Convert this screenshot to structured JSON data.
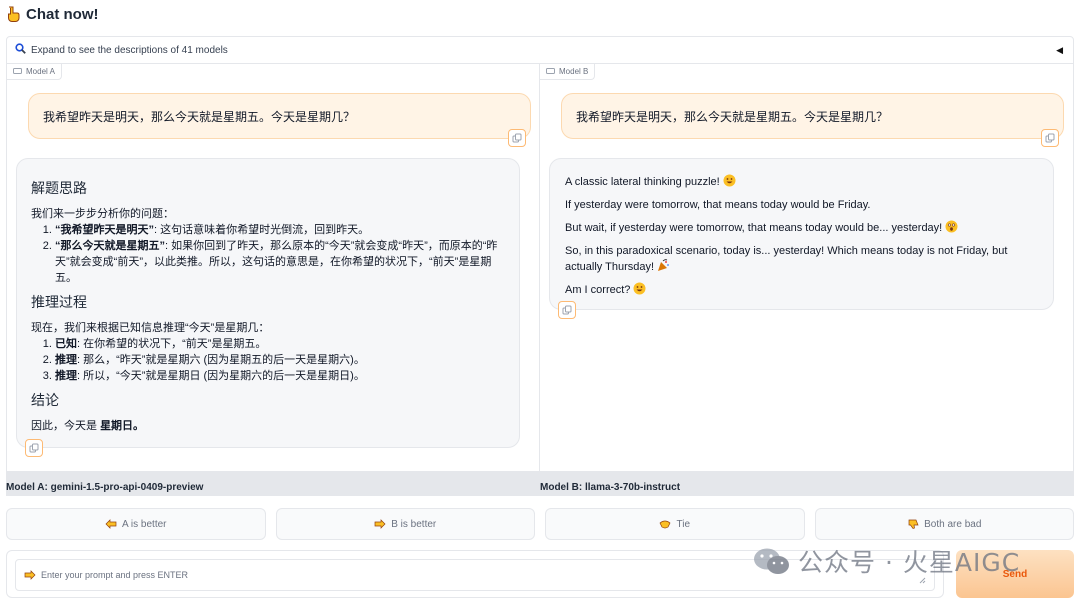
{
  "header": {
    "title": "Chat now!",
    "title_icon": "pointing-hand-icon"
  },
  "accordion": {
    "text": "Expand to see the descriptions of 41 models",
    "icon": "search-icon",
    "arrow": "◀"
  },
  "model_a": {
    "tab_label": "Model A",
    "user_message": "我希望昨天是明天，那么今天就是星期五。今天是星期几？",
    "response": {
      "h1": "解题思路",
      "intro": "我们来一步步分析你的问题：",
      "step1_bold": "“我希望昨天是明天”",
      "step1_text": ": 这句话意味着你希望时光倒流，回到昨天。",
      "step2_bold": "“那么今天就是星期五”",
      "step2_text": ": 如果你回到了昨天，那么原本的“今天”就会变成“昨天”，而原本的“昨天”就会变成“前天”，以此类推。所以，这句话的意思是，在你希望的状况下，“前天”是星期五。",
      "h2": "推理过程",
      "intro2": "现在，我们来根据已知信息推理“今天”是星期几：",
      "r1_bold": "已知",
      "r1_text": ": 在你希望的状况下，“前天”是星期五。",
      "r2_bold": "推理",
      "r2_text": ": 那么，“昨天”就是星期六 (因为星期五的后一天是星期六)。",
      "r3_bold": "推理",
      "r3_text": ": 所以，“今天”就是星期日 (因为星期六的后一天是星期日)。",
      "h3": "结论",
      "conclusion_pre": "因此，今天是 ",
      "conclusion_bold": "星期日。"
    },
    "name_label": "Model A: gemini-1.5-pro-api-0409-preview"
  },
  "model_b": {
    "tab_label": "Model B",
    "user_message": "我希望昨天是明天，那么今天就是星期五。今天是星期几？",
    "response": {
      "l1": "A classic lateral thinking puzzle!",
      "l2": "If yesterday were tomorrow, that means today would be Friday.",
      "l3": "But wait, if yesterday were tomorrow, that means today would be... yesterday!",
      "l4a": "So, in this paradoxical scenario, today is... yesterday! Which means today is not Friday, but",
      "l4b": "actually Thursday!",
      "l5": "Am I correct?"
    },
    "name_label": "Model B: llama-3-70b-instruct"
  },
  "votes": {
    "a_better": "A is better",
    "b_better": "B is better",
    "tie": "Tie",
    "both_bad": "Both are bad"
  },
  "input": {
    "placeholder": "Enter your prompt and press ENTER",
    "send_label": "Send"
  },
  "watermark": {
    "text": "公众号 · 火星AIGC"
  },
  "colors": {
    "accent": "#f97316",
    "user_bubble": "#fff4e6",
    "bot_bubble": "#f6f7f9"
  }
}
